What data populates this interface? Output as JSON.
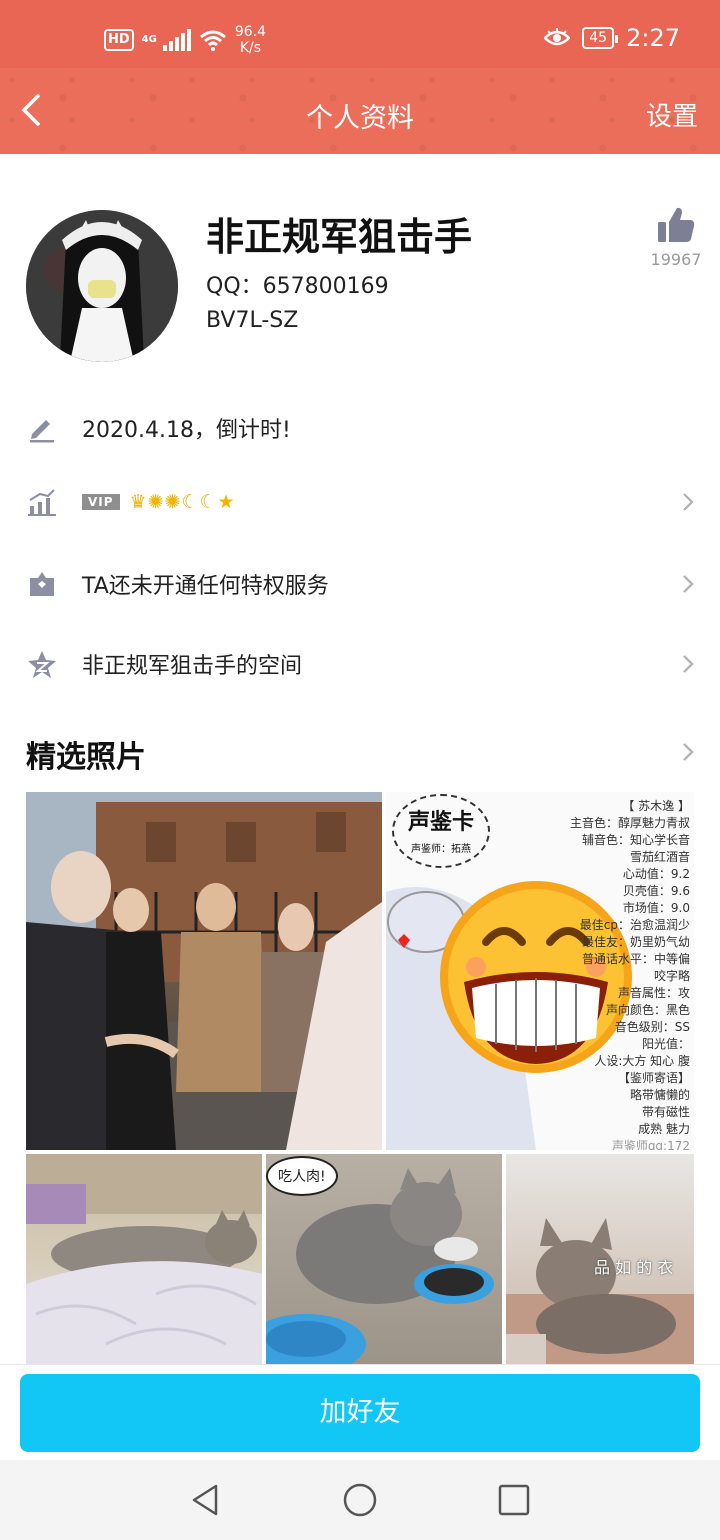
{
  "status_bar": {
    "hd": "HD",
    "network": "4G",
    "network_sub": "4G",
    "speed_value": "96.4",
    "speed_unit": "K/s",
    "battery": "45",
    "time": "2:27"
  },
  "header": {
    "title": "个人资料",
    "settings": "设置"
  },
  "profile": {
    "name": "非正规军狙击手",
    "qq": "QQ：657800169",
    "code": "BV7L-SZ",
    "likes": "19967"
  },
  "rows": {
    "signature": "2020.4.18，倒计时!",
    "vip_badge": "VIP",
    "levels": "♛✺✺☾☾★",
    "privilege": "TA还未开通任何特权服务",
    "space": "非正规军狙击手的空间"
  },
  "photos": {
    "section_title": "精选照片",
    "card_stamp_title": "声鉴卡",
    "card_stamp_sub": "声鉴师：拓燕",
    "card_lines": [
      "【 苏木逸 】",
      "主音色：醇厚魅力青叔",
      "辅音色：知心学长音",
      "雪茄红酒音",
      "心动值：9.2",
      "贝壳值：9.6",
      "市场值：9.0",
      "最佳cp：治愈温润少",
      "最佳友：奶里奶气幼",
      "普通话水平：中等偏",
      "咬字略",
      "声音属性：攻",
      "声向颜色：黑色",
      "音色级别：SS",
      "阳光值：",
      "人设:大方 知心 腹",
      "【鉴师寄语】",
      "略带慵懒的",
      "带有磁性",
      "成熟 魅力",
      "声鉴师qq:172"
    ],
    "cat_bubble": "吃人肉!",
    "cat_caption": "品 如 的 衣"
  },
  "actions": {
    "add_friend": "加好友"
  },
  "colors": {
    "header": "#ea6e59",
    "status_bar": "#e96654",
    "button": "#12c6f6",
    "icon_gray": "#8c8fa3"
  }
}
